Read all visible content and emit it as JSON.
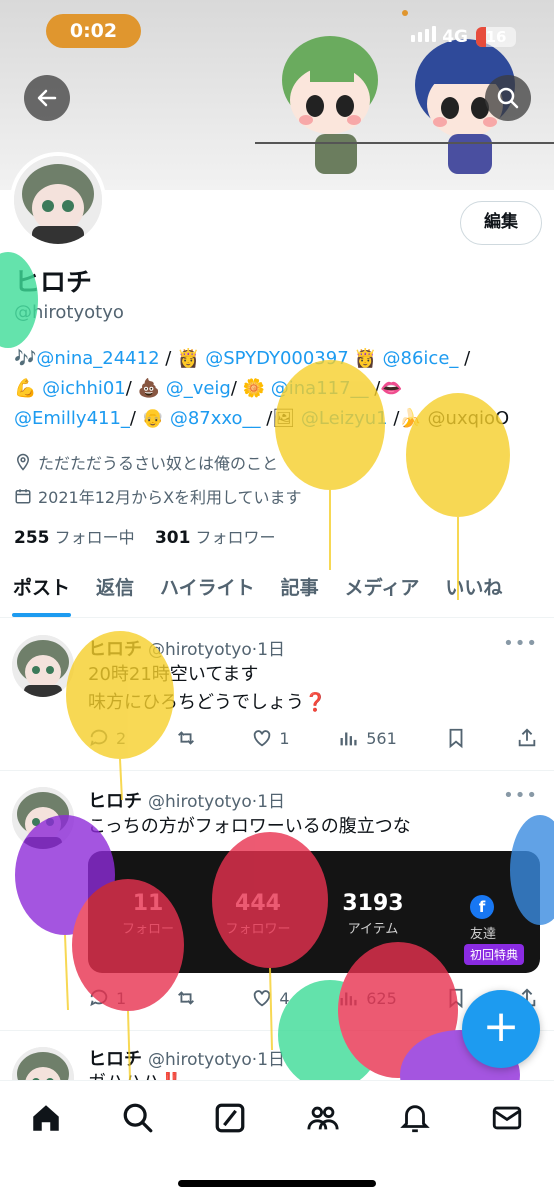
{
  "status_bar": {
    "time": "0:02",
    "network": "4G",
    "battery": "16"
  },
  "profile": {
    "display_name": "ヒロチ",
    "handle": "@hirotyotyo",
    "edit_label": "編集",
    "bio_lines": [
      [
        "🎶",
        "@nina_24412",
        " / 👸 ",
        "@SPYDY000397",
        " 👸 ",
        "@86ice_",
        " /"
      ],
      [
        "💪 ",
        "@ichhi01",
        "/ 💩 ",
        "@_veig",
        "/ 🌼 ",
        "@ina117__",
        " /👄"
      ],
      [
        "",
        "@Emilly411_",
        "/ 👴 ",
        "@87xxo__",
        " /🖼 ",
        "@Leizyu1",
        " /🍌 @uxqioO"
      ]
    ],
    "location": "ただただうるさい奴とは俺のこと",
    "joined": "2021年12月からXを利用しています",
    "following_count": "255",
    "following_label": "フォロー中",
    "followers_count": "301",
    "followers_label": "フォロワー"
  },
  "tabs": [
    "ポスト",
    "返信",
    "ハイライト",
    "記事",
    "メディア",
    "いいね"
  ],
  "posts": [
    {
      "name": "ヒロチ",
      "handle": "@hirotyotyo",
      "time": "1日",
      "lines": [
        "20時21時空いてます",
        "味方にひろちどうでしょう❓"
      ],
      "replies": "2",
      "retweets": "",
      "likes": "1",
      "views": "561"
    },
    {
      "name": "ヒロチ",
      "handle": "@hirotyotyo",
      "time": "1日",
      "lines": [
        "こっちの方がフォロワーいるの腹立つな"
      ],
      "replies": "1",
      "retweets": "",
      "likes": "4",
      "views": "625",
      "card": {
        "stats": [
          {
            "n": "11",
            "l": "フォロー"
          },
          {
            "n": "444",
            "l": "フォロワー"
          },
          {
            "n": "3193",
            "l": "アイテム"
          },
          {
            "n": "f",
            "l": "友達"
          }
        ],
        "promo": "初回特典"
      }
    },
    {
      "name": "ヒロチ",
      "handle": "@hirotyotyo",
      "time": "1日",
      "lines": [
        "ガハハハ‼️"
      ]
    }
  ],
  "fab_label": "+",
  "colors": {
    "accent": "#1d9bf0",
    "time_pill": "#e0962e"
  }
}
